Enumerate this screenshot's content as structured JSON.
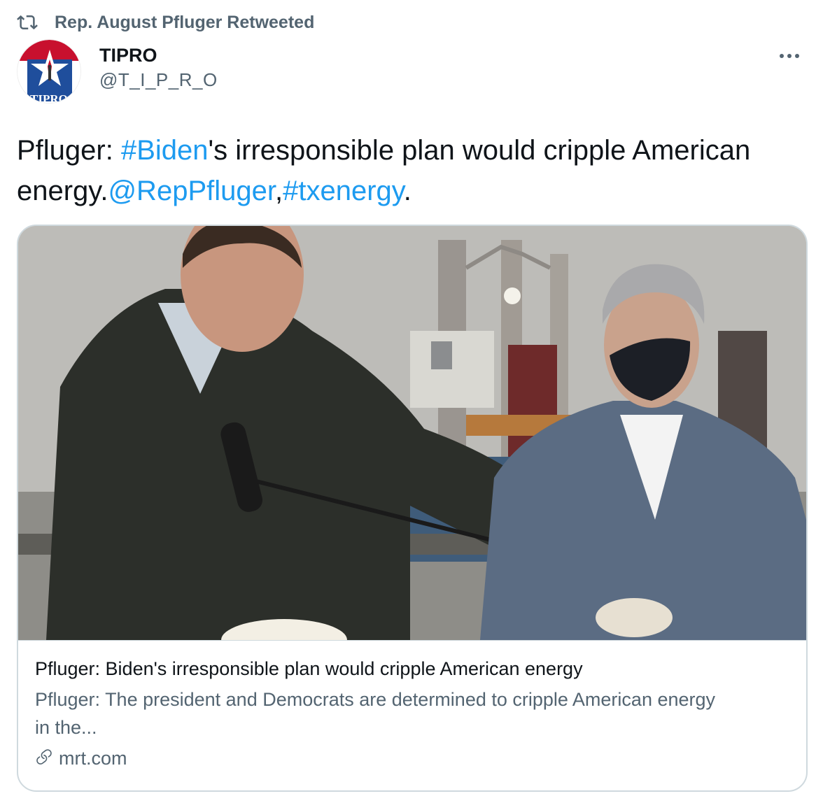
{
  "social_context": {
    "text": "Rep. August Pfluger Retweeted"
  },
  "author": {
    "display_name": "TIPRO",
    "handle": "@T_I_P_R_O",
    "avatar_text": "TIPRO"
  },
  "tweet": {
    "segments": [
      {
        "text": "Pfluger: ",
        "link": false
      },
      {
        "text": "#Biden",
        "link": true
      },
      {
        "text": "'s irresponsible plan would cripple American energy.",
        "link": false
      },
      {
        "text": "@RepPfluger",
        "link": true
      },
      {
        "text": ",",
        "link": false
      },
      {
        "text": "#txenergy",
        "link": true
      },
      {
        "text": ".",
        "link": false
      }
    ]
  },
  "card": {
    "title": "Pfluger: Biden's irresponsible plan would cripple American energy",
    "description": "Pfluger: The president and Democrats are determined to cripple American energy in the...",
    "domain": "mrt.com"
  },
  "colors": {
    "link": "#1d9bf0",
    "secondary_text": "#536471",
    "border": "#cfd9de",
    "avatar_red": "#c8102e",
    "avatar_blue": "#1f4e9c"
  },
  "icons": {
    "retweet": "retweet-icon",
    "more": "more-icon",
    "link": "link-icon"
  }
}
